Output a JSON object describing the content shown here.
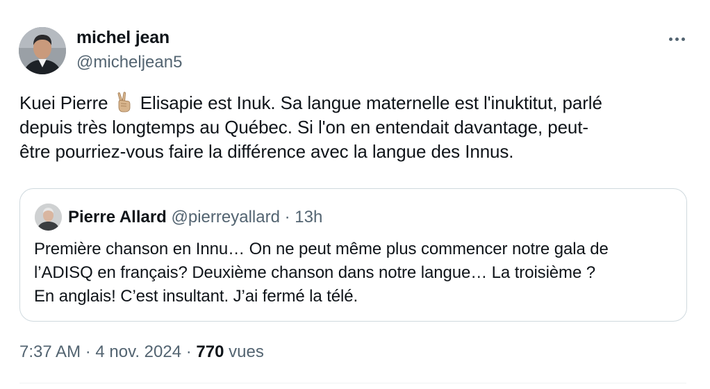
{
  "author": {
    "name": "michel jean",
    "handle": "@micheljean5"
  },
  "tweet": {
    "lines": [
      "Kuei Pierre",
      "Elisapie est Inuk. Sa langue maternelle est l'inuktitut, parlé",
      "depuis très longtemps au Québec. Si l'on en entendait davantage, peut-",
      "être pourriez-vous faire la différence avec la langue des Innus."
    ],
    "emoji": "victory-hand-emoji"
  },
  "quoted": {
    "name": "Pierre Allard",
    "handle": "@pierreyallard",
    "separator": "·",
    "age": "13h",
    "lines": [
      "Première chanson en Innu… On ne peut même plus commencer notre gala de",
      "l’ADISQ en français? Deuxième chanson dans notre langue… La troisième ?",
      "En anglais! C’est insultant. J’ai fermé la télé."
    ]
  },
  "meta": {
    "time": "7:37 AM",
    "separator": "·",
    "date": "4 nov. 2024",
    "views_count": "770",
    "views_label": "vues"
  },
  "icons": {
    "more": "more-horizontal-icon"
  },
  "colors": {
    "text": "#0f1419",
    "secondary": "#536471",
    "border": "#cfd9de"
  }
}
